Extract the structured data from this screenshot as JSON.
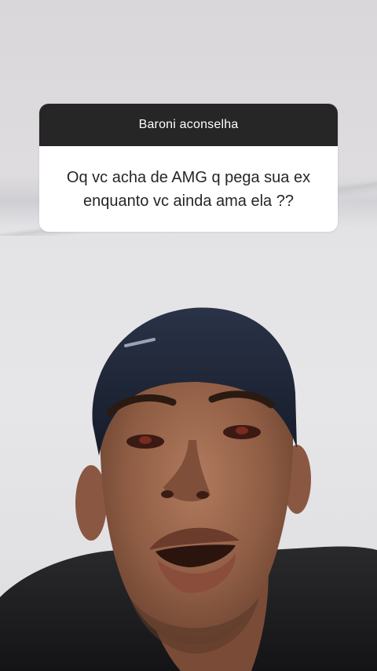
{
  "story": {
    "question_sticker": {
      "header": "Baroni aconselha",
      "question": "Oq vc acha de AMG q pega sua ex enquanto vc ainda ama ela ??"
    },
    "background_video": {
      "subject": "person-face-video-frame",
      "cap_color": "#1e2537",
      "wall_color": "#e4e4e6"
    }
  }
}
